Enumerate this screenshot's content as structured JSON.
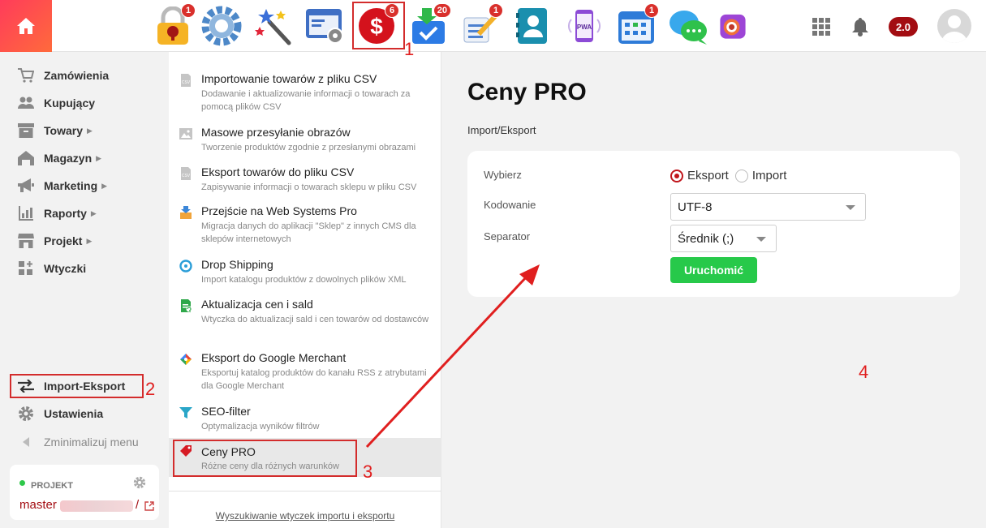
{
  "topbar": {
    "apps": [
      {
        "name": "lock-app",
        "badge": "1"
      },
      {
        "name": "settings-app",
        "badge": ""
      },
      {
        "name": "magic-wand-app",
        "badge": ""
      },
      {
        "name": "window-settings-app",
        "badge": ""
      },
      {
        "name": "prices-app",
        "badge": "6"
      },
      {
        "name": "download-tasks-app",
        "badge": "20"
      },
      {
        "name": "notes-app",
        "badge": "1"
      },
      {
        "name": "contacts-app",
        "badge": ""
      },
      {
        "name": "pwa-app",
        "badge": ""
      },
      {
        "name": "calendar-app",
        "badge": "1"
      },
      {
        "name": "chat-app",
        "badge": ""
      },
      {
        "name": "camera-app",
        "badge": ""
      }
    ],
    "pwa_text": "PWA",
    "version": "2.0"
  },
  "sidebar": {
    "items": [
      {
        "label": "Zamówienia",
        "icon": "cart-icon"
      },
      {
        "label": "Kupujący",
        "icon": "users-icon"
      },
      {
        "label": "Towary",
        "icon": "box-icon"
      },
      {
        "label": "Magazyn",
        "icon": "warehouse-icon"
      },
      {
        "label": "Marketing",
        "icon": "megaphone-icon"
      },
      {
        "label": "Raporty",
        "icon": "chart-icon"
      },
      {
        "label": "Projekt",
        "icon": "store-icon"
      },
      {
        "label": "Wtyczki",
        "icon": "plugins-icon"
      }
    ],
    "import_export": "Import-Eksport",
    "settings": "Ustawienia",
    "minimize": "Zminimalizuj menu",
    "project_label": "PROJEKT",
    "project_name": "master",
    "project_slash": "/"
  },
  "plugins": {
    "items": [
      {
        "title": "Importowanie towarów z pliku CSV",
        "desc": "Dodawanie i aktualizowanie informacji o towarach za pomocą plików CSV"
      },
      {
        "title": "Masowe przesyłanie obrazów",
        "desc": "Tworzenie produktów zgodnie z przesłanymi obrazami"
      },
      {
        "title": "Eksport towarów do pliku CSV",
        "desc": "Zapisywanie informacji o towarach sklepu w pliku CSV"
      },
      {
        "title": "Przejście na Web Systems Pro",
        "desc": "Migracja danych do aplikacji \"Sklep\" z innych CMS dla sklepów internetowych"
      },
      {
        "title": "Drop Shipping",
        "desc": "Import katalogu produktów z dowolnych plików XML"
      },
      {
        "title": "Aktualizacja cen i sald",
        "desc": "Wtyczka do aktualizacji sald i cen towarów od dostawców"
      },
      {
        "title": "Eksport do Google Merchant",
        "desc": "Eksportuj katalog produktów do kanału RSS z atrybutami dla Google Merchant"
      },
      {
        "title": "SEO-filter",
        "desc": "Optymalizacja wyników filtrów"
      },
      {
        "title": "Ceny PRO",
        "desc": "Różne ceny dla różnych warunków"
      }
    ],
    "footer_link": "Wyszukiwanie wtyczek importu i eksportu"
  },
  "main": {
    "title": "Ceny PRO",
    "subtitle": "Import/Eksport",
    "form": {
      "choose_label": "Wybierz",
      "option_export": "Eksport",
      "option_import": "Import",
      "selected": "Eksport",
      "encoding_label": "Kodowanie",
      "encoding_value": "UTF-8",
      "separator_label": "Separator",
      "separator_value": "Średnik (;)",
      "run_button": "Uruchomić"
    }
  },
  "annotations": {
    "n1": "1",
    "n2": "2",
    "n3": "3",
    "n4": "4"
  },
  "colors": {
    "accent": "#a30d12",
    "annotation": "#e01f1f",
    "run": "#27c94a"
  }
}
